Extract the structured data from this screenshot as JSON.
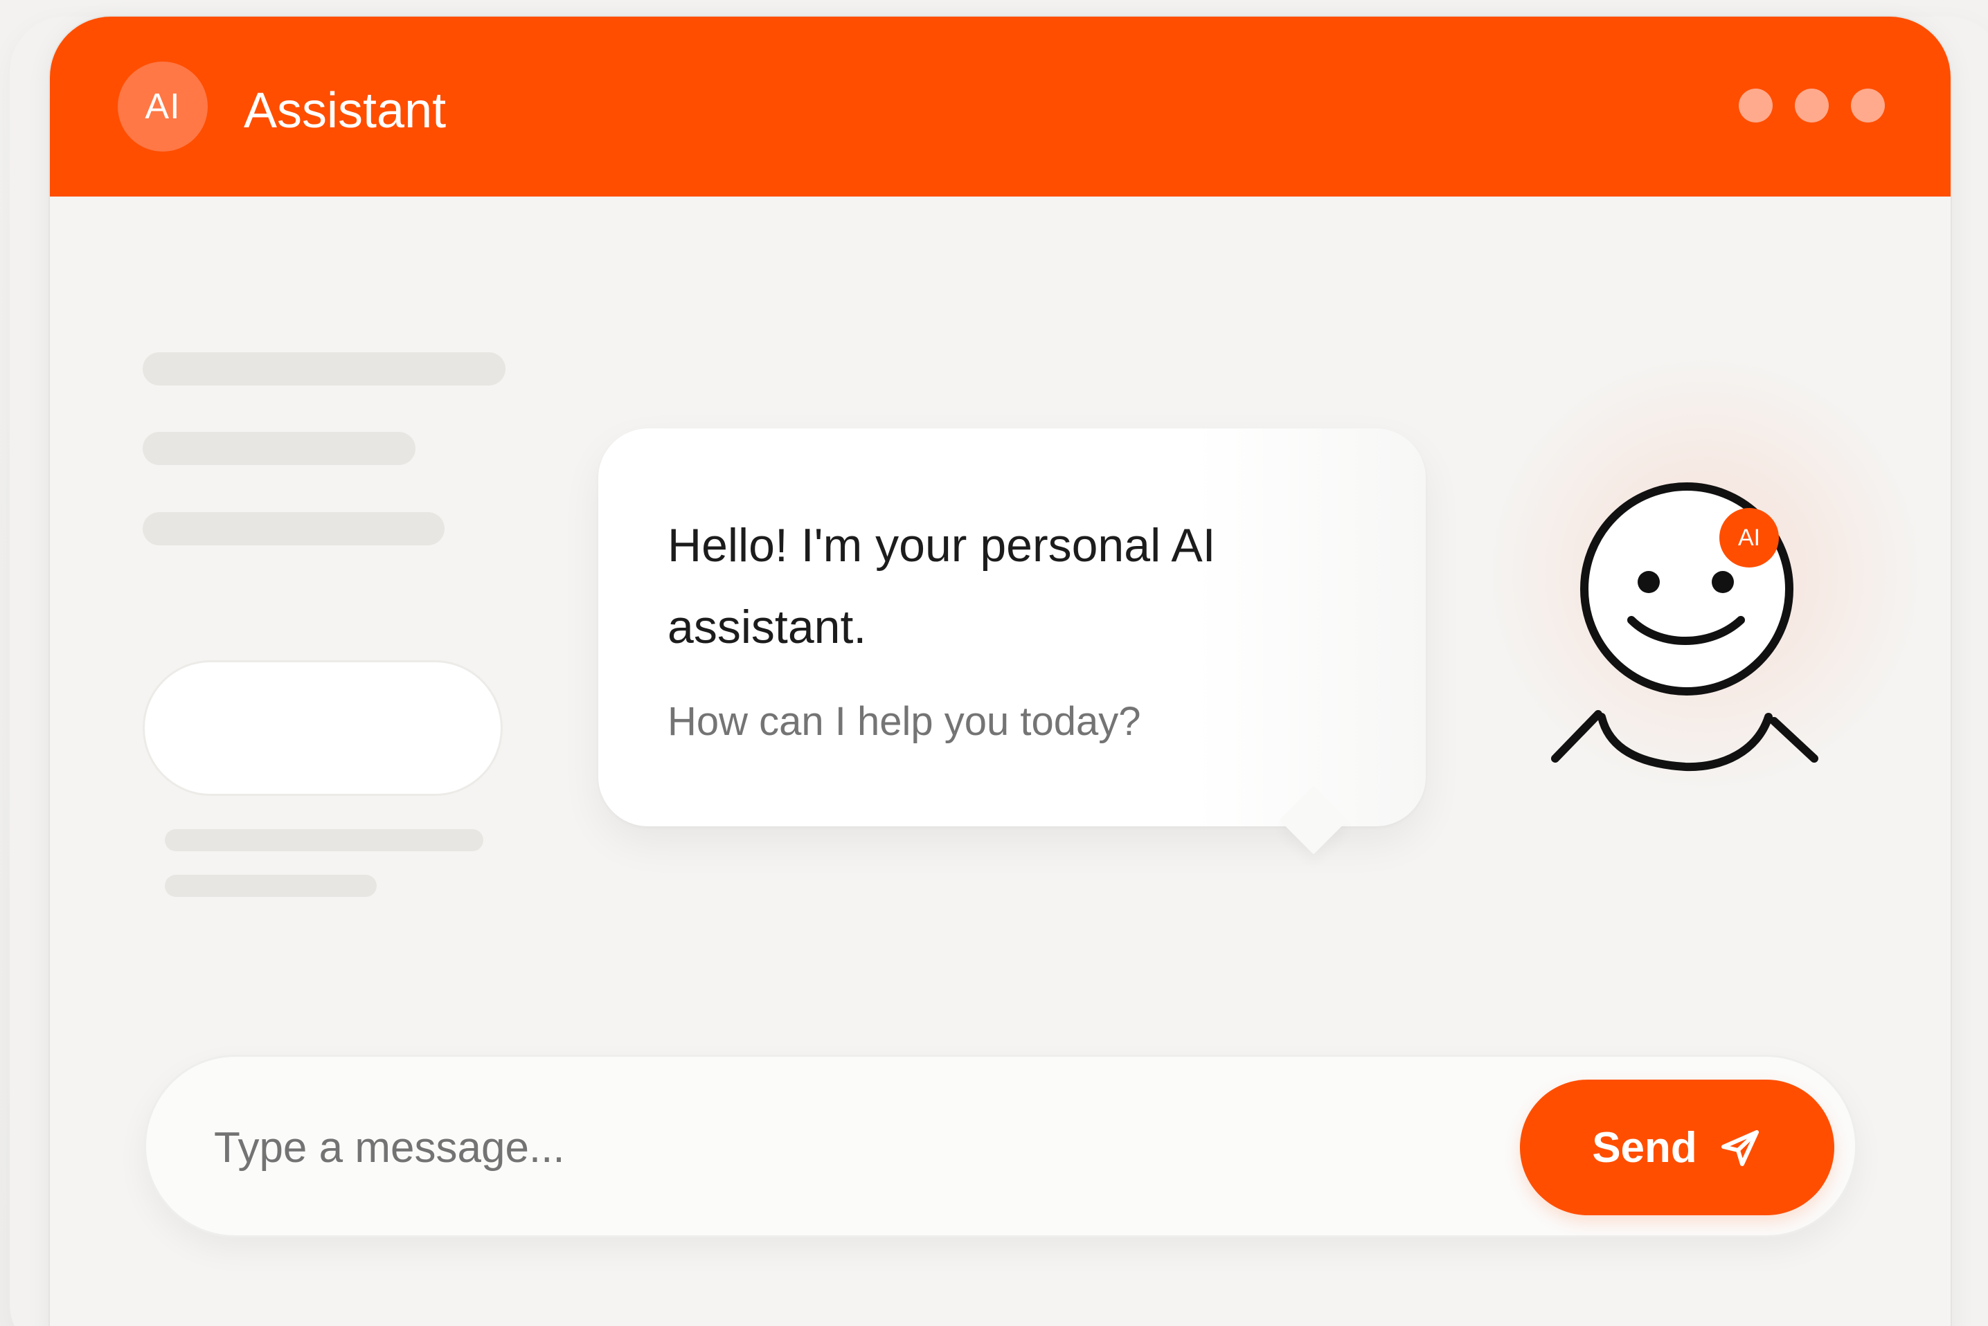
{
  "header": {
    "avatar_label": "AI",
    "title": "Assistant",
    "menu_icon": "more-dots-icon"
  },
  "assistant": {
    "greeting": "Hello! I'm your personal AI assistant.",
    "prompt": "How can I help you today?",
    "badge": "AI",
    "mascot_icon": "smiling-face-icon"
  },
  "composer": {
    "placeholder": "Type a message...",
    "send_label": "Send",
    "send_icon": "paper-plane-icon"
  },
  "colors": {
    "brand": "#ff4e00",
    "header_avatar": "#ff7846",
    "background": "#f5f4f2",
    "muted_text": "#747474"
  }
}
